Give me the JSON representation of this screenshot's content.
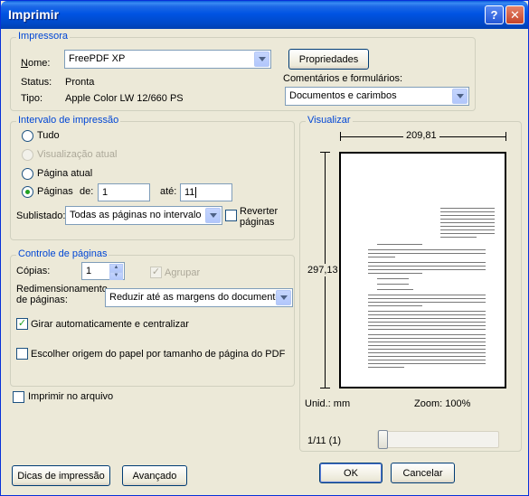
{
  "window": {
    "title": "Imprimir",
    "help_glyph": "?",
    "close_glyph": "✕"
  },
  "printer": {
    "legend": "Impressora",
    "name_label": "Nome:",
    "name_value": "FreePDF XP",
    "status_label": "Status:",
    "status_value": "Pronta",
    "type_label": "Tipo:",
    "type_value": "Apple Color LW 12/660 PS",
    "properties_button": "Propriedades",
    "comments_label": "Comentários e formulários:",
    "comments_value": "Documentos e carimbos"
  },
  "range": {
    "legend": "Intervalo de impressão",
    "all_label": "Tudo",
    "current_view_label": "Visualização atual",
    "current_page_label": "Página atual",
    "pages_label": "Páginas",
    "from_label": "de:",
    "from_value": "1",
    "to_label": "até:",
    "to_value": "11",
    "subset_label": "Sublistado:",
    "subset_value": "Todas as páginas no intervalo",
    "reverse_label_1": "Reverter",
    "reverse_label_2": "páginas",
    "selected": "pages"
  },
  "handling": {
    "legend": "Controle de páginas",
    "copies_label": "Cópias:",
    "copies_value": "1",
    "collate_label": "Agrupar",
    "collate_checked": true,
    "scaling_label_1": "Redimensionamento",
    "scaling_label_2": "de páginas:",
    "scaling_value": "Reduzir até as margens do documento",
    "autorotate_label": "Girar automaticamente e centralizar",
    "autorotate_checked": true,
    "paper_source_label": "Escolher origem do papel por tamanho de página do PDF",
    "paper_source_checked": false
  },
  "print_to_file_label": "Imprimir no arquivo",
  "preview": {
    "legend": "Visualizar",
    "width_value": "209,81",
    "height_value": "297,13",
    "units_label": "Unid.: mm",
    "zoom_label": "Zoom: 100%",
    "page_indicator": "1/11 (1)"
  },
  "buttons": {
    "tips": "Dicas de impressão",
    "advanced": "Avançado",
    "ok": "OK",
    "cancel": "Cancelar"
  },
  "colors": {
    "legend_blue": "#0046d5",
    "dialog_bg": "#ece9d8",
    "titlebar": "#0054e3"
  },
  "icons": [
    "help-icon",
    "close-icon",
    "chevron-down-icon",
    "spin-up-icon",
    "spin-down-icon",
    "checkmark-icon"
  ]
}
